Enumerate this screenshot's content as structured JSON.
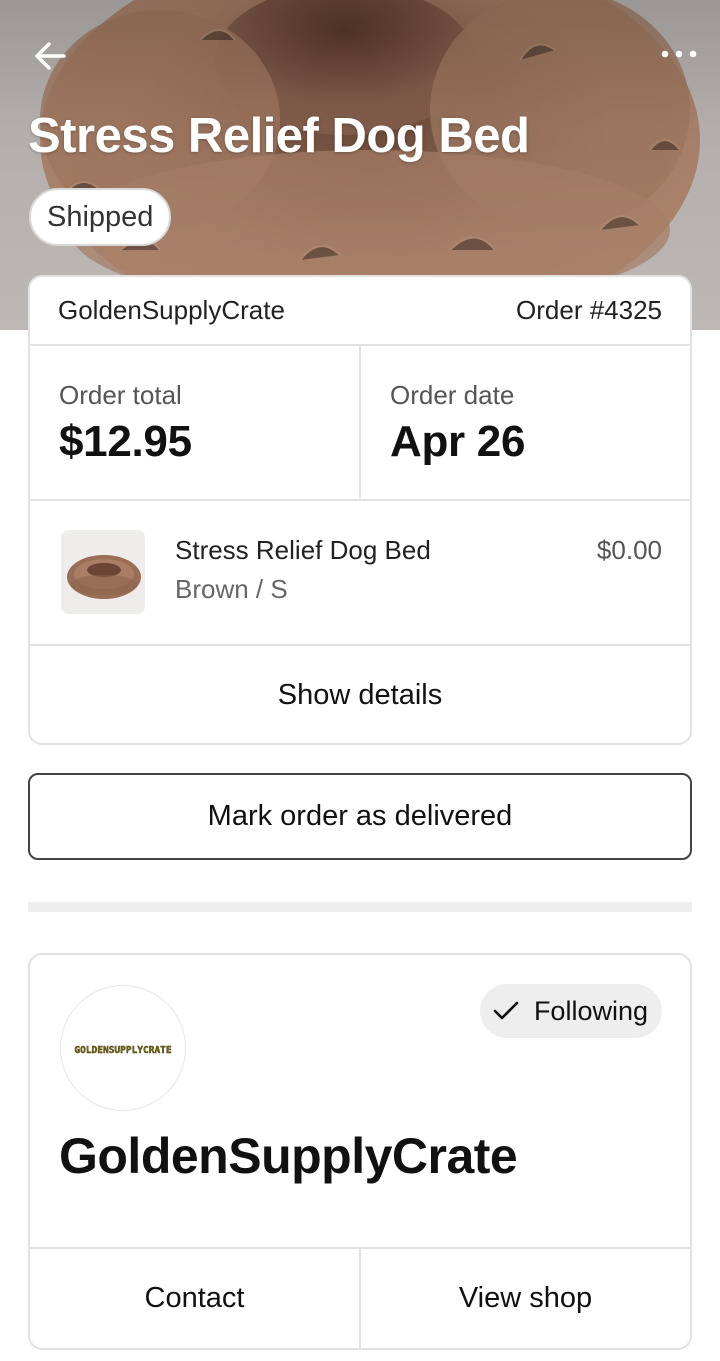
{
  "header": {
    "title": "Stress Relief Dog Bed",
    "status": "Shipped",
    "back_icon": "arrow-left-icon",
    "more_icon": "more-horizontal-icon"
  },
  "order": {
    "shop_name": "GoldenSupplyCrate",
    "order_number": "Order #4325",
    "total_label": "Order total",
    "total_value": "$12.95",
    "date_label": "Order date",
    "date_value": "Apr 26",
    "item": {
      "name": "Stress Relief Dog Bed",
      "variant": "Brown / S",
      "price": "$0.00"
    },
    "show_details_label": "Show details"
  },
  "mark_delivered_label": "Mark order as delivered",
  "shop": {
    "logo_text": "GOLDENSUPPLYCRATE",
    "follow_label": "Following",
    "follow_icon": "checkmark-icon",
    "name": "GoldenSupplyCrate",
    "contact_label": "Contact",
    "view_shop_label": "View shop"
  },
  "colors": {
    "bed_brown": "#a57a61",
    "logo_text": "#7a6a12",
    "follow_bg": "#eeeeee"
  }
}
